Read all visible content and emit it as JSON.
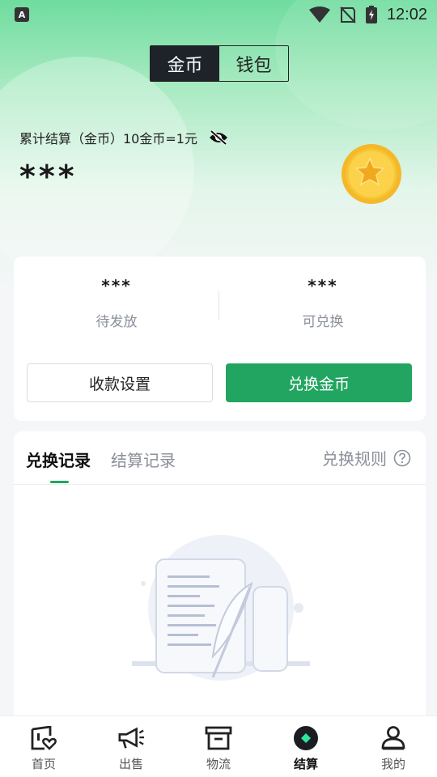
{
  "status_bar": {
    "app_badge": "A",
    "time": "12:02"
  },
  "segment": {
    "options": [
      "金币",
      "钱包"
    ],
    "selected": "金币"
  },
  "summary": {
    "label": "累计结算（金币）10金币=1元",
    "value": "***"
  },
  "stats": [
    {
      "value": "***",
      "label": "待发放"
    },
    {
      "value": "***",
      "label": "可兑换"
    }
  ],
  "buttons": {
    "payment_settings": "收款设置",
    "exchange_coins": "兑换金币"
  },
  "records": {
    "tabs": [
      "兑换记录",
      "结算记录"
    ],
    "active_tab": "兑换记录",
    "rules_label": "兑换规则"
  },
  "nav": {
    "items": [
      {
        "label": "首页",
        "icon": "home-shop-icon"
      },
      {
        "label": "出售",
        "icon": "megaphone-icon"
      },
      {
        "label": "物流",
        "icon": "box-icon"
      },
      {
        "label": "结算",
        "icon": "settlement-icon"
      },
      {
        "label": "我的",
        "icon": "profile-icon"
      }
    ],
    "active": "结算"
  },
  "colors": {
    "accent": "#21a561",
    "dark": "#1e2229",
    "muted": "#8a8f99"
  }
}
